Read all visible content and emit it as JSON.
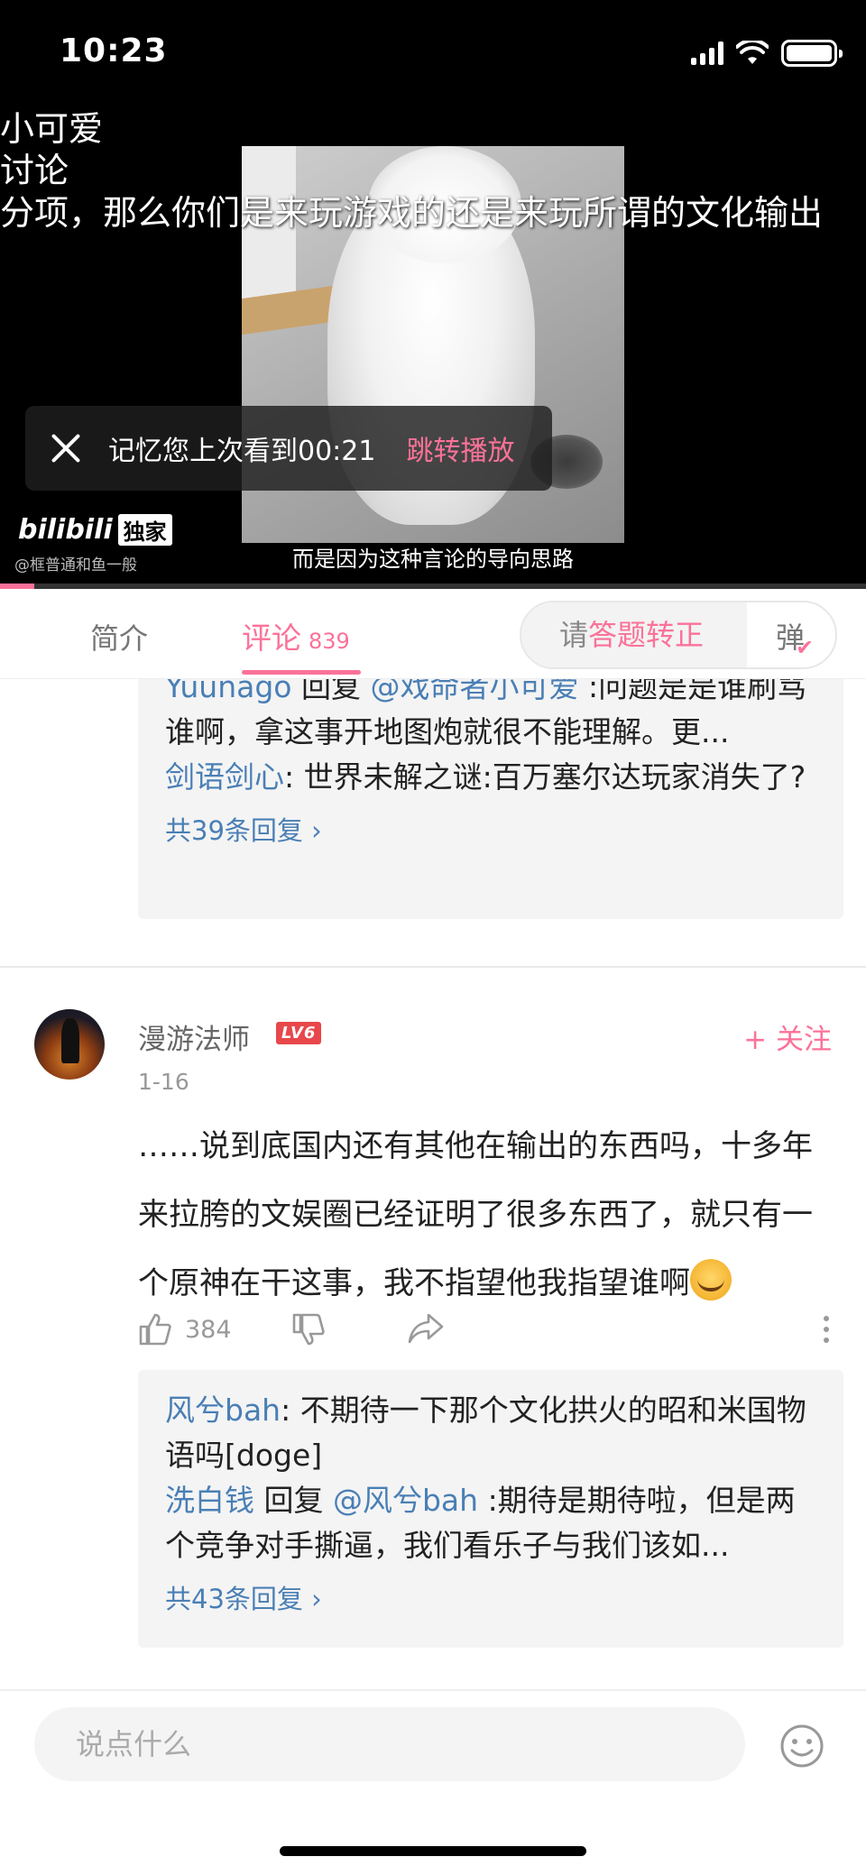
{
  "status_bar": {
    "time": "10:23"
  },
  "video": {
    "danmaku": [
      "小可爱",
      "讨论",
      "分项，那么你们是来玩游戏的还是来玩所谓的文化输出"
    ],
    "subtitle": "而是因为这种言论的导向思路",
    "resume_toast": {
      "text": "记忆您上次看到00:21",
      "action": "跳转播放"
    },
    "logo": {
      "brand": "bilibili",
      "exclusive": "独家"
    },
    "watermark": "@框普通和鱼一般",
    "progress": 0.04,
    "accent_color": "#fb7299"
  },
  "tabs": {
    "intro": "简介",
    "comments": "评论",
    "comments_count": "839",
    "danmaku_placeholder_prefix": "请",
    "danmaku_placeholder_highlight": "答题转正",
    "danmaku_button": "弹"
  },
  "thread1": {
    "replies": [
      {
        "user": "Yuunago",
        "reply_word": " 回复 ",
        "target": "@戏命者小可爱",
        "text": " :问题是是谁刷骂谁啊，拿这事开地图炮就很不能理解。更..."
      },
      {
        "user": "剑语剑心",
        "text": ": 世界未解之谜:百万塞尔达玩家消失了?"
      }
    ],
    "more": "共39条回复 ›"
  },
  "comment": {
    "username": "漫游法师",
    "level": "LV6",
    "follow": "+ 关注",
    "date": "1-16",
    "text": "……说到底国内还有其他在输出的东西吗，十多年来拉胯的文娱圈已经证明了很多东西了，就只有一个原神在干这事，我不指望他我指望谁啊",
    "likes": "384",
    "replies": [
      {
        "user": "风兮bah",
        "text": ": 不期待一下那个文化拱火的昭和米国物语吗[doge]"
      },
      {
        "user": "洗白钱",
        "reply_word": " 回复 ",
        "target": "@风兮bah",
        "text": " :期待是期待啦，但是两个竞争对手撕逼，我们看乐子与我们该如..."
      }
    ],
    "more": "共43条回复 ›"
  },
  "bottom": {
    "input_placeholder": "说点什么"
  }
}
